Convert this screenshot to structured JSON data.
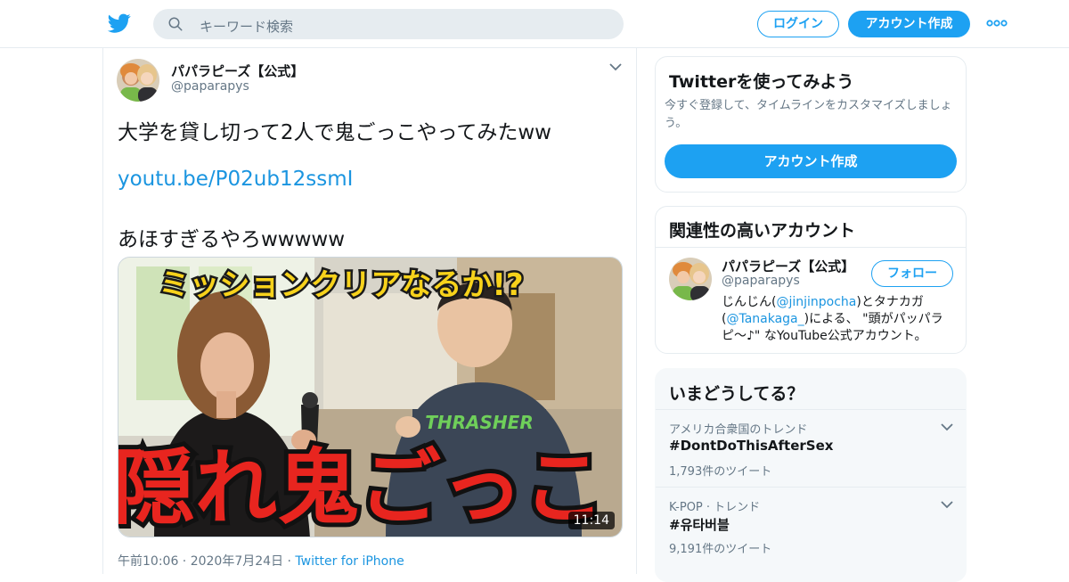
{
  "topbar": {
    "search_placeholder": "キーワード検索",
    "login_label": "ログイン",
    "signup_label": "アカウント作成"
  },
  "colors": {
    "brand": "#1da1f2",
    "link": "#1b95e0",
    "muted": "#657786",
    "border": "#e6ecf0"
  },
  "tweet": {
    "display_name": "パパラピーズ【公式】",
    "handle": "@paparapys",
    "line1": "大学を貸し切って2人で鬼ごっこやってみたww",
    "link": "youtu.be/P02ub12ssmI",
    "line2": "あほすぎるやろwwwww",
    "media": {
      "caption_top": "ミッションクリアなるか!?",
      "caption_bottom": "隠れ鬼ごっこ",
      "shirt_text": "THRASHER",
      "duration": "11:14"
    },
    "timestamp": "午前10:06 · 2020年7月24日",
    "separator": " · ",
    "source": "Twitter for iPhone"
  },
  "try_twitter": {
    "title": "Twitterを使ってみよう",
    "description": "今すぐ登録して、タイムラインをカスタマイズしましょう。",
    "button_label": "アカウント作成"
  },
  "related": {
    "title": "関連性の高いアカウント",
    "account": {
      "display_name": "パパラピーズ【公式】",
      "handle": "@paparapys",
      "follow_label": "フォロー",
      "bio_part1": "じんじん(",
      "bio_mention1": "@jinjinpocha",
      "bio_part2": ")とタナカガ(",
      "bio_mention2": "@Tanakaga_",
      "bio_part3": ")による、 \"頭がパッパラピ〜♪\" なYouTube公式アカウント。"
    }
  },
  "trends": {
    "title": "いまどうしてる？",
    "items": [
      {
        "context": "アメリカ合衆国のトレンド",
        "tag": "#DontDoThisAfterSex",
        "count": "1,793件のツイート"
      },
      {
        "context": "K-POP · トレンド",
        "tag": "#유타버블",
        "count": "9,191件のツイート"
      }
    ]
  }
}
